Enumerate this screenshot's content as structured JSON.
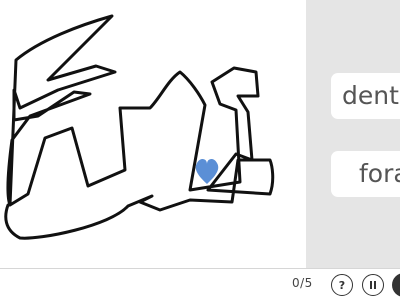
{
  "puzzle": {
    "shape_stroke_color": "#111111",
    "marker_icon": "heart-icon",
    "marker_color": "#5b8fd6"
  },
  "choices": [
    {
      "label": "dent"
    },
    {
      "label": "fora"
    }
  ],
  "footer": {
    "progress_text": "0/5",
    "help_label": "?",
    "pause_icon": "pause-icon",
    "more_button_color": "#333333"
  }
}
